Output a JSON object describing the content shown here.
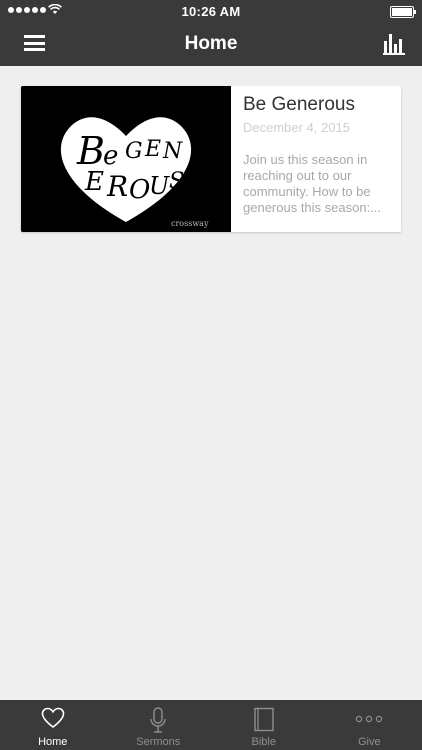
{
  "status": {
    "time": "10:26 AM"
  },
  "navbar": {
    "title": "Home"
  },
  "card": {
    "title": "Be Generous",
    "date": "December 4, 2015",
    "description": "Join us this season in reaching out to our community.  How to be generous this season:...",
    "image_watermark": "crossway",
    "image_letters": [
      "B",
      "e",
      "G",
      "E",
      "N",
      "E",
      "R",
      "O",
      "U",
      "S"
    ]
  },
  "tabs": [
    {
      "label": "Home",
      "icon": "heart-icon",
      "active": true
    },
    {
      "label": "Sermons",
      "icon": "microphone-icon",
      "active": false
    },
    {
      "label": "Bible",
      "icon": "book-icon",
      "active": false
    },
    {
      "label": "Give",
      "icon": "more-icon",
      "active": false
    }
  ],
  "colors": {
    "bar": "#3a3a3a",
    "background": "#efefef",
    "tab_active": "#ffffff",
    "tab_inactive": "#8f8f8f"
  }
}
